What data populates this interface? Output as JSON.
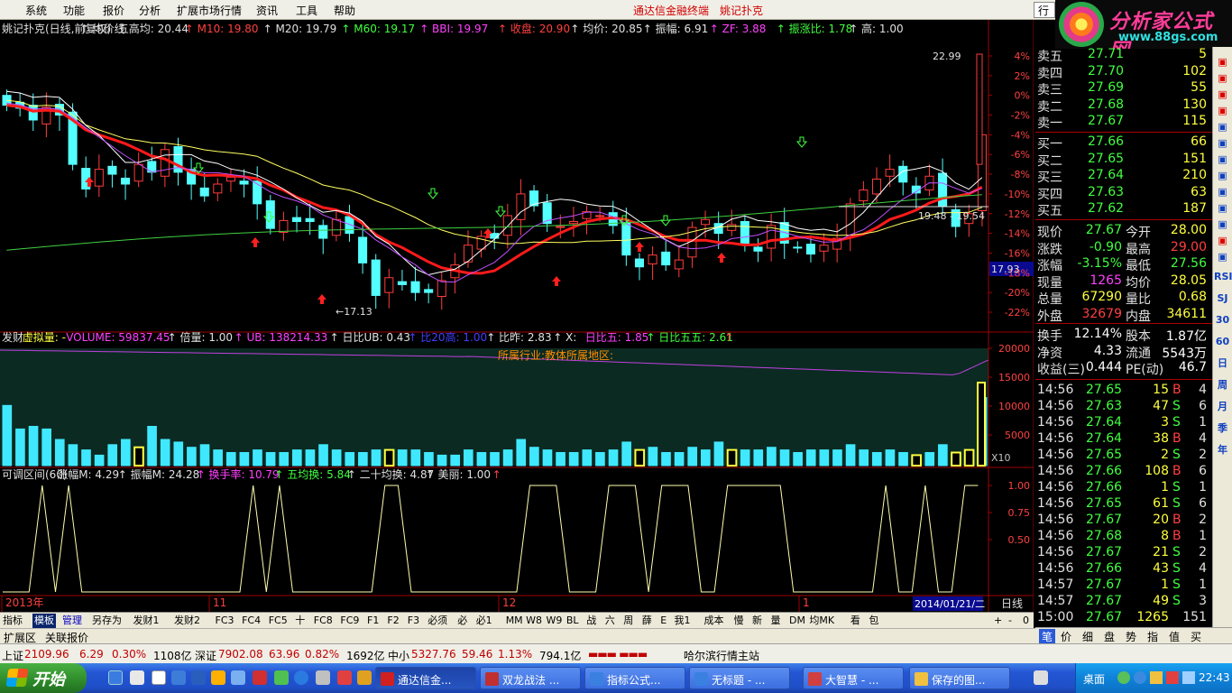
{
  "menu": {
    "items": [
      "系统",
      "功能",
      "报价",
      "分析",
      "扩展市场行情",
      "资讯",
      "工具",
      "帮助"
    ],
    "title_left": "通达信金融终端",
    "title_right": "姚记扑克",
    "trade_btn": "行"
  },
  "logo": {
    "brand": "分析家公式网",
    "url": "www.88gs.com"
  },
  "chart": {
    "main_header": [
      {
        "text": "姚记扑克(日线,前复权)",
        "color": "#e0e0e0"
      },
      {
        "text": "↑ 均价线",
        "color": "#e0e0e0"
      },
      {
        "text": "五高均: 20.44",
        "color": "#e0e0e0"
      },
      {
        "text": "↑ M10: 19.80",
        "color": "#ff4040"
      },
      {
        "text": "↑ M20: 19.79",
        "color": "#e0e0e0"
      },
      {
        "text": "↑ M60: 19.17",
        "color": "#40ff40"
      },
      {
        "text": "↑ BBI: 19.97",
        "color": "#ff40ff"
      },
      {
        "text": "↑ 收盘: 20.90",
        "color": "#ff4040"
      },
      {
        "text": "↑ 均价: 20.85",
        "color": "#e0e0e0"
      },
      {
        "text": "↑ 振幅: 6.91",
        "color": "#e0e0e0"
      },
      {
        "text": "↑ ZF: 3.88",
        "color": "#ff40ff"
      },
      {
        "text": "↑ 振涨比: 1.78",
        "color": "#40ff40"
      },
      {
        "text": "↑ 高: 1.00",
        "color": "#e0e0e0"
      }
    ],
    "main_axis": [
      "4%",
      "2%",
      "0%",
      "-2%",
      "-4%",
      "-6%",
      "-8%",
      "-10%",
      "-12%",
      "-14%",
      "-16%",
      "-18%",
      "-20%",
      "-22%"
    ],
    "price_labels": {
      "high": "22.99",
      "low": "←17.13",
      "range": "19.48 - 19.54",
      "current": "17.93"
    },
    "vol_header": [
      {
        "text": "发财",
        "color": "#e0e0e0"
      },
      {
        "text": "虚拟量: -",
        "color": "#ffff40"
      },
      {
        "text": "VOLUME: 59837.45",
        "color": "#ff40ff"
      },
      {
        "text": "↑ 倍量: 1.00",
        "color": "#e0e0e0"
      },
      {
        "text": "↑ UB: 138214.33",
        "color": "#ff40ff"
      },
      {
        "text": "↑ 日比UB: 0.43",
        "color": "#e0e0e0"
      },
      {
        "text": "↑ 比20高: 1.00",
        "color": "#4040ff"
      },
      {
        "text": "↑ 比昨: 2.83",
        "color": "#e0e0e0"
      },
      {
        "text": "↑ X:",
        "color": "#e0e0e0"
      },
      {
        "text": "日比五: 1.85",
        "color": "#ff40ff"
      },
      {
        "text": "↑ 日比五五: 2.61",
        "color": "#40ff40"
      },
      {
        "text": "↑",
        "color": "#ff4040"
      }
    ],
    "vol_note": "所属行业:教体所属地区:",
    "vol_axis": [
      "20000",
      "15000",
      "10000",
      "5000"
    ],
    "vol_unit": "X10",
    "ind_header": [
      {
        "text": "可调区间(60)",
        "color": "#e0e0e0"
      },
      {
        "text": "涨幅M: 4.29",
        "color": "#e0e0e0"
      },
      {
        "text": "↑ 振幅M: 24.28",
        "color": "#e0e0e0"
      },
      {
        "text": "↑ 换手率: 10.79",
        "color": "#ff40ff"
      },
      {
        "text": "↑ 五均换: 5.84",
        "color": "#40ff40"
      },
      {
        "text": "↑ 二十均换: 4.87",
        "color": "#e0e0e0"
      },
      {
        "text": "↑ 美丽: 1.00",
        "color": "#e0e0e0"
      },
      {
        "text": "↑",
        "color": "#ff4040"
      }
    ],
    "ind_axis": [
      "1.00",
      "0.75",
      "0.50"
    ],
    "date_labels": [
      "2013年",
      "11",
      "12",
      "1"
    ],
    "date_cursor": "2014/01/21/二",
    "period": "日线"
  },
  "chart_data": {
    "type": "candlestick",
    "title": "姚记扑克(日线,前复权)",
    "ylabel": "%",
    "ylim": [
      -23,
      5
    ],
    "highlight_values": {
      "high": 22.99,
      "low": 17.13,
      "close": 20.9
    },
    "volume_ylim": [
      0,
      22000
    ],
    "volume_unit": "X10",
    "indicator": {
      "name": "美丽",
      "ylim": [
        0.3,
        1.05
      ],
      "values": [
        0,
        0,
        0,
        1,
        0,
        1,
        0,
        0,
        0,
        0,
        0,
        0,
        0,
        0,
        0,
        0,
        0,
        0,
        0,
        1,
        0,
        1,
        0,
        0,
        0,
        0,
        0,
        0,
        0,
        1,
        1,
        0,
        0,
        0,
        0,
        0,
        0,
        0,
        0,
        0,
        1,
        1,
        1,
        0,
        0,
        0,
        1,
        1,
        1,
        0,
        1,
        1,
        1,
        0,
        0,
        1,
        1,
        1,
        1,
        1,
        0,
        0,
        0,
        0,
        0,
        0,
        0,
        1,
        0,
        0,
        1,
        0,
        0,
        1,
        1
      ]
    }
  },
  "side": {
    "asks": [
      {
        "label": "卖五",
        "price": "27.71",
        "vol": "5"
      },
      {
        "label": "卖四",
        "price": "27.70",
        "vol": "102"
      },
      {
        "label": "卖三",
        "price": "27.69",
        "vol": "55"
      },
      {
        "label": "卖二",
        "price": "27.68",
        "vol": "130"
      },
      {
        "label": "卖一",
        "price": "27.67",
        "vol": "115"
      }
    ],
    "bids": [
      {
        "label": "买一",
        "price": "27.66",
        "vol": "66"
      },
      {
        "label": "买二",
        "price": "27.65",
        "vol": "151"
      },
      {
        "label": "买三",
        "price": "27.64",
        "vol": "210"
      },
      {
        "label": "买四",
        "price": "27.63",
        "vol": "63"
      },
      {
        "label": "买五",
        "price": "27.62",
        "vol": "187"
      }
    ],
    "quote": [
      {
        "l1": "现价",
        "v1": "27.67",
        "c1": "#40ff40",
        "l2": "今开",
        "v2": "28.00",
        "c2": "#ffff40"
      },
      {
        "l1": "涨跌",
        "v1": "-0.90",
        "c1": "#40ff40",
        "l2": "最高",
        "v2": "29.00",
        "c2": "#ff4040"
      },
      {
        "l1": "涨幅",
        "v1": "-3.15%",
        "c1": "#40ff40",
        "l2": "最低",
        "v2": "27.56",
        "c2": "#40ff40"
      },
      {
        "l1": "现量",
        "v1": "1265",
        "c1": "#ff40ff",
        "l2": "均价",
        "v2": "28.05",
        "c2": "#ffff40"
      },
      {
        "l1": "总量",
        "v1": "67290",
        "c1": "#ffff40",
        "l2": "量比",
        "v2": "0.68",
        "c2": "#ffff40"
      },
      {
        "l1": "外盘",
        "v1": "32679",
        "c1": "#ff4040",
        "l2": "内盘",
        "v2": "34611",
        "c2": "#ffff40"
      }
    ],
    "fin": [
      {
        "l1": "换手",
        "v1": "12.14%",
        "l2": "股本",
        "v2": "1.87亿"
      },
      {
        "l1": "净资",
        "v1": "4.33",
        "l2": "流通",
        "v2": "5543万"
      },
      {
        "l1": "收益(三)",
        "v1": "0.444",
        "l2": "PE(动)",
        "v2": "46.7"
      }
    ],
    "trades": [
      {
        "t": "14:56",
        "p": "27.65",
        "v": "15",
        "s": "B",
        "n": "4"
      },
      {
        "t": "14:56",
        "p": "27.63",
        "v": "47",
        "s": "S",
        "n": "6"
      },
      {
        "t": "14:56",
        "p": "27.64",
        "v": "3",
        "s": "S",
        "n": "1"
      },
      {
        "t": "14:56",
        "p": "27.64",
        "v": "38",
        "s": "B",
        "n": "4"
      },
      {
        "t": "14:56",
        "p": "27.65",
        "v": "2",
        "s": "S",
        "n": "2"
      },
      {
        "t": "14:56",
        "p": "27.66",
        "v": "108",
        "s": "B",
        "n": "6"
      },
      {
        "t": "14:56",
        "p": "27.66",
        "v": "1",
        "s": "S",
        "n": "1"
      },
      {
        "t": "14:56",
        "p": "27.65",
        "v": "61",
        "s": "S",
        "n": "6"
      },
      {
        "t": "14:56",
        "p": "27.67",
        "v": "20",
        "s": "B",
        "n": "2"
      },
      {
        "t": "14:56",
        "p": "27.68",
        "v": "8",
        "s": "B",
        "n": "1"
      },
      {
        "t": "14:56",
        "p": "27.67",
        "v": "21",
        "s": "S",
        "n": "2"
      },
      {
        "t": "14:56",
        "p": "27.66",
        "v": "43",
        "s": "S",
        "n": "4"
      },
      {
        "t": "14:57",
        "p": "27.67",
        "v": "1",
        "s": "S",
        "n": "1"
      },
      {
        "t": "14:57",
        "p": "27.67",
        "v": "49",
        "s": "S",
        "n": "3"
      },
      {
        "t": "15:00",
        "p": "27.67",
        "v": "1265",
        "s": "",
        "n": "151"
      }
    ],
    "tabs": [
      "笔",
      "价",
      "细",
      "盘",
      "势",
      "指",
      "值",
      "买"
    ]
  },
  "right_toolbar": [
    "RSI",
    "SJ",
    "30",
    "60",
    "日",
    "周",
    "月",
    "季",
    "年"
  ],
  "bottom_tabs": [
    "指标",
    "模板",
    "管理",
    "另存为",
    "发财1",
    "发财2",
    "FC3",
    "FC4",
    "FC5",
    "十",
    "FC8",
    "FC9",
    "F1",
    "F2",
    "F3",
    "必须",
    "必",
    "必1",
    "MM",
    "W8",
    "W9",
    "BL",
    "战",
    "六",
    "周",
    "薛",
    "E",
    "我1",
    "成本",
    "慢",
    "新",
    "量",
    "DM",
    "均MK",
    "看",
    "包"
  ],
  "bottom_right": [
    "+",
    "-",
    "0"
  ],
  "ext_tabs": [
    "扩展区",
    "关联报价"
  ],
  "status": {
    "sh_label": "上证",
    "sh_val": "2109.96",
    "sh_chg": "6.29",
    "sh_pct": "0.30%",
    "sh_amt": "1108亿",
    "sz_label": "深证",
    "sz_val": "7902.08",
    "sz_chg": "63.96",
    "sz_pct": "0.82%",
    "sz_amt": "1692亿",
    "zx_label": "中小",
    "zx_val": "5327.76",
    "zx_chg": "59.46",
    "zx_pct": "1.13%",
    "zx_amt": "794.1亿",
    "station": "哈尔滨行情主站"
  },
  "taskbar": {
    "start": "开始",
    "tasks": [
      "通达信金...",
      "双龙战法 ...",
      "指标公式...",
      "无标题 - ...",
      "大智慧 - ...",
      "保存的图..."
    ],
    "desktop": "桌面",
    "clock": "22:43"
  }
}
